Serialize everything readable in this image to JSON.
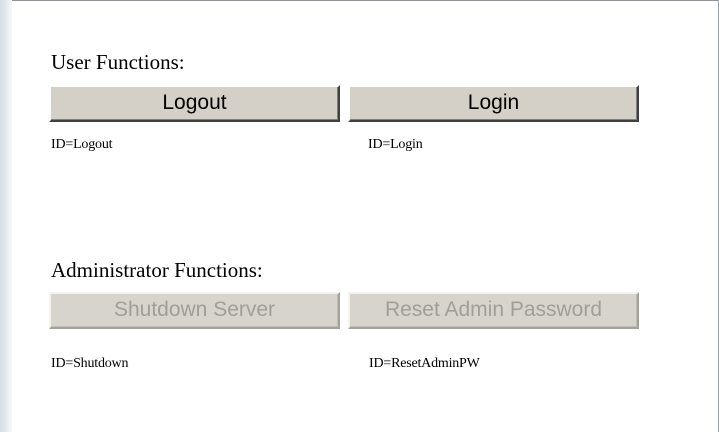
{
  "user_section": {
    "heading": "User Functions:",
    "buttons": [
      {
        "label": "Logout",
        "id_label": "ID=Logout",
        "enabled": true
      },
      {
        "label": "Login",
        "id_label": "ID=Login",
        "enabled": true
      }
    ]
  },
  "admin_section": {
    "heading": "Administrator Functions:",
    "buttons": [
      {
        "label": "Shutdown Server",
        "id_label": "ID=Shutdown",
        "enabled": false
      },
      {
        "label": "Reset Admin Password",
        "id_label": "ID=ResetAdminPW",
        "enabled": false
      }
    ]
  },
  "colors": {
    "button_face": "#d4d0c8",
    "disabled_text": "#a19e98",
    "background": "#ffffff"
  }
}
